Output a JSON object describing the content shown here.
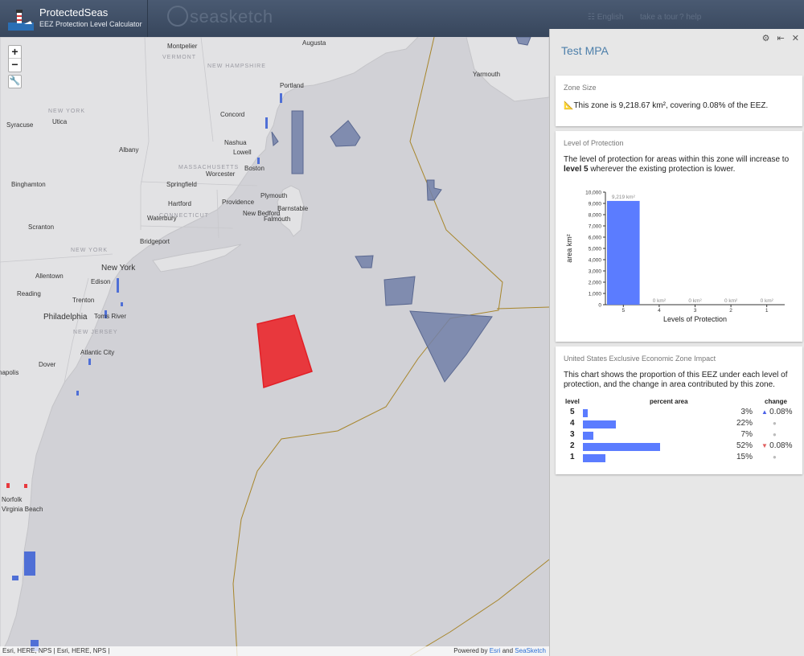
{
  "header": {
    "brand_title": "ProtectedSeas",
    "brand_subtitle": "EEZ Protection Level Calculator",
    "seasketch_word": "seasketch",
    "links": [
      "English",
      "take a tour",
      "help"
    ]
  },
  "map": {
    "zoom_in": "+",
    "zoom_out": "−",
    "tool_glyph": "🔧",
    "labels": {
      "montpelier": "Montpelier",
      "vermont": "VERMONT",
      "augusta": "Augusta",
      "new_hampshire": "NEW HAMPSHIRE",
      "portland": "Portland",
      "yarmouth": "Yarmouth",
      "new_york_state": "NEW YORK",
      "syracuse": "Syracuse",
      "utica": "Utica",
      "concord": "Concord",
      "albany": "Albany",
      "nashua": "Nashua",
      "lowell": "Lowell",
      "boston": "Boston",
      "massachusetts": "MASSACHUSETTS",
      "worcester": "Worcester",
      "binghamton": "Binghamton",
      "springfield": "Springfield",
      "plymouth": "Plymouth",
      "barnstable": "Barnstable",
      "hartford": "Hartford",
      "providence": "Providence",
      "new_bedford": "New Bedford",
      "falmouth": "Falmouth",
      "connecticut": "CONNECTICUT",
      "waterbury": "Waterbury",
      "scranton": "Scranton",
      "bridgeport": "Bridgeport",
      "new_york_city": "New York",
      "allentown": "Allentown",
      "edison": "Edison",
      "reading": "Reading",
      "trenton": "Trenton",
      "philadelphia": "Philadelphia",
      "toms_river": "Toms River",
      "new_jersey": "NEW JERSEY",
      "atlantic_city": "Atlantic City",
      "dover": "Dover",
      "annapolis": "napolis",
      "norfolk": "Norfolk",
      "virginia_beach": "Virginia Beach"
    },
    "attribution": "Esri, HERE, NPS | Esri, HERE, NPS |",
    "powered_prefix": "Powered by",
    "powered_esri": "Esri",
    "powered_and": "and",
    "powered_seasketch": "SeaSketch"
  },
  "panel": {
    "title": "Test MPA",
    "icons": [
      "gear-icon",
      "collapse-icon",
      "close-icon"
    ],
    "zone_size": {
      "heading": "Zone Size",
      "icon": "📐",
      "text_prefix": "This zone is ",
      "area": "9,218.67 km²",
      "text_suffix": ", covering 0.08% of the EEZ."
    },
    "level_of_protection": {
      "heading": "Level of Protection",
      "text_prefix": "The level of protection for areas within this zone will increase to ",
      "level_text": "level 5",
      "text_suffix": " wherever the existing protection is lower."
    },
    "eez_impact": {
      "heading": "United States Exclusive Economic Zone Impact",
      "description": "This chart shows the proportion of this EEZ under each level of protection, and the change in area contributed by this zone.",
      "col_level": "level",
      "col_percent": "percent area",
      "col_change": "change",
      "rows": [
        {
          "level": "5",
          "percent": "3%",
          "pct_value": 3,
          "change": "0.08%",
          "direction": "up"
        },
        {
          "level": "4",
          "percent": "22%",
          "pct_value": 22,
          "change": "",
          "direction": "none"
        },
        {
          "level": "3",
          "percent": "7%",
          "pct_value": 7,
          "change": "",
          "direction": "none"
        },
        {
          "level": "2",
          "percent": "52%",
          "pct_value": 52,
          "change": "0.08%",
          "direction": "down"
        },
        {
          "level": "1",
          "percent": "15%",
          "pct_value": 15,
          "change": "",
          "direction": "none"
        }
      ]
    }
  },
  "colors": {
    "bar": "#5b7cff",
    "zone_fill": "#e8383d",
    "mpa_fill": "#7280a8",
    "eez_line": "#a7852a"
  },
  "chart_data": {
    "type": "bar",
    "categories": [
      "5",
      "4",
      "3",
      "2",
      "1"
    ],
    "values": [
      9219,
      0,
      0,
      0,
      0
    ],
    "data_labels": [
      "9,219 km²",
      "0 km²",
      "0 km²",
      "0 km²",
      "0 km²"
    ],
    "xlabel": "Levels of Protection",
    "ylabel": "area km²",
    "ylim": [
      0,
      10000
    ],
    "yticks": [
      "0",
      "1,000",
      "2,000",
      "3,000",
      "4,000",
      "5,000",
      "6,000",
      "7,000",
      "8,000",
      "9,000",
      "10,000"
    ]
  }
}
